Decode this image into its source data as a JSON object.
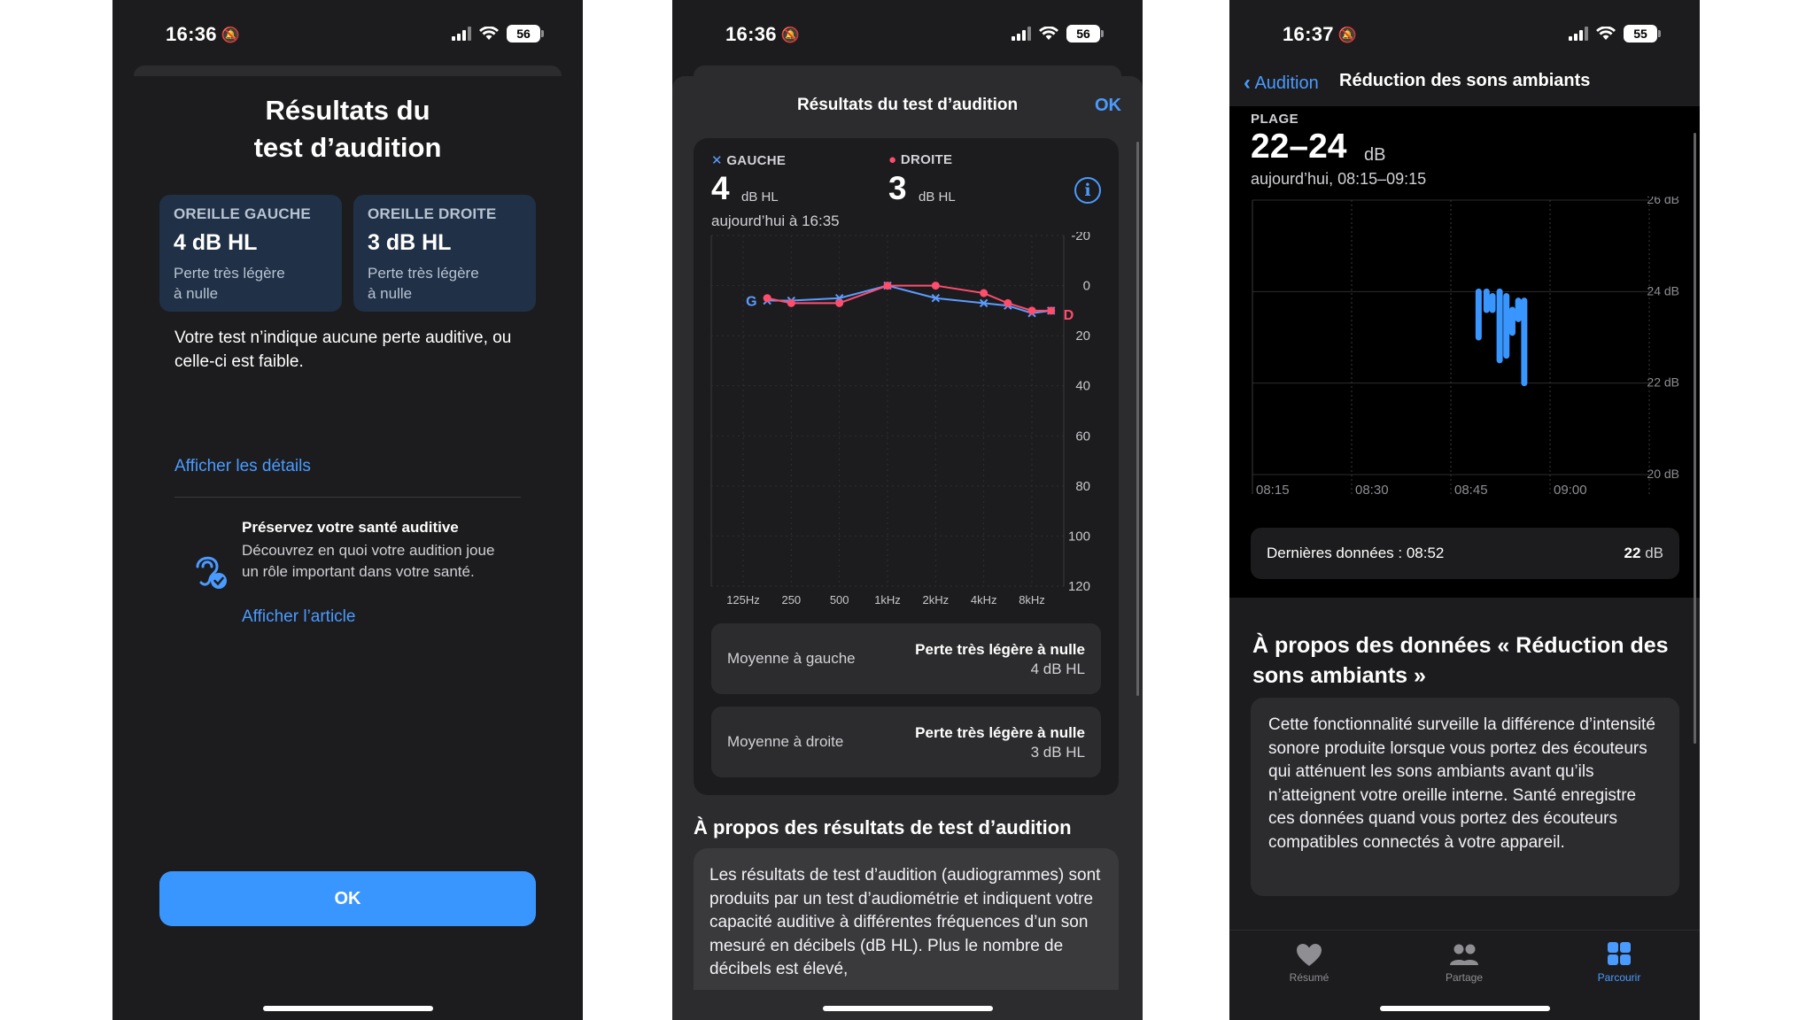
{
  "status": {
    "phone1_time": "16:36",
    "phone2_time": "16:36",
    "phone3_time": "16:37",
    "battery1": "56",
    "battery2": "56",
    "battery3": "55"
  },
  "phone1": {
    "title_line1": "Résultats du",
    "title_line2": "test d’audition",
    "left_ear": {
      "label": "OREILLE GAUCHE",
      "value": "4 dB HL",
      "desc1": "Perte très légère",
      "desc2": "à nulle"
    },
    "right_ear": {
      "label": "OREILLE DROITE",
      "value": "3 dB HL",
      "desc1": "Perte très légère",
      "desc2": "à nulle"
    },
    "message": "Votre test n’indique aucune perte auditive, ou celle-ci est faible.",
    "details_link": "Afficher les détails",
    "article_title": "Préservez votre santé auditive",
    "article_body": "Découvrez en quoi votre audition joue un rôle important dans votre santé.",
    "article_link": "Afficher l’article",
    "ok_label": "OK"
  },
  "phone2": {
    "header": "Résultats du test d’audition",
    "ok_label": "OK",
    "left_legend": "GAUCHE",
    "right_legend": "DROITE",
    "left_value": "4",
    "right_value": "3",
    "unit": "dB HL",
    "date": "aujourd’hui à 16:35",
    "avg_left_label": "Moyenne à gauche",
    "avg_left_result": "Perte très légère à nulle",
    "avg_left_value": "4 dB HL",
    "avg_right_label": "Moyenne à droite",
    "avg_right_result": "Perte très légère à nulle",
    "avg_right_value": "3 dB HL",
    "about_title": "À propos des résultats de test d’audition",
    "about_body": "Les résultats de test d’audition (audiogrammes) sont produits par un test d’audiométrie et indiquent votre capacité auditive à différentes fréquences d’un son mesuré en décibels (dB HL). Plus le nombre de décibels est élevé,"
  },
  "phone3": {
    "back_label": "Audition",
    "title": "Réduction des sons ambiants",
    "range_label": "PLAGE",
    "range_value": "22–24",
    "range_unit": "dB",
    "date": "aujourd’hui, 08:15–09:15",
    "last_label": "Dernières données : 08:52",
    "last_value": "22",
    "last_unit": "dB",
    "about_title": "À propos des données « Réduction des sons ambiants »",
    "about_body": "Cette fonctionnalité surveille la différence d’intensité sonore produite lorsque vous portez des écouteurs qui atténuent les sons ambiants avant qu’ils n’atteignent votre oreille interne. Santé enregistre ces données quand vous portez des écouteurs compatibles connectés à votre appareil.",
    "tabs": [
      {
        "label": "Résumé",
        "icon": "heart-icon"
      },
      {
        "label": "Partage",
        "icon": "people-icon"
      },
      {
        "label": "Parcourir",
        "icon": "grid-icon"
      }
    ]
  },
  "colors": {
    "accent": "#4a9bff",
    "left_series": "#5b9cff",
    "right_series": "#ff4d6d",
    "noise_bars": "#3a96ff"
  },
  "chart_data": [
    {
      "type": "line",
      "xlabel": "",
      "ylabel": "",
      "x": [
        "125Hz",
        "250",
        "500",
        "1kHz",
        "2kHz",
        "4kHz",
        "8kHz"
      ],
      "ylim": [
        -20,
        120
      ],
      "y_inverted": true,
      "yticks": [
        "-20",
        "0",
        "20",
        "40",
        "60",
        "80",
        "100",
        "120"
      ],
      "start_label_left": "G",
      "end_label_right": "D",
      "series": [
        {
          "name": "GAUCHE",
          "marker": "x",
          "points": [
            [
              0.5,
              6
            ],
            [
              1,
              6
            ],
            [
              2,
              5
            ],
            [
              3,
              0
            ],
            [
              4,
              5
            ],
            [
              5,
              7
            ],
            [
              5.5,
              8
            ],
            [
              6,
              11
            ],
            [
              6.4,
              10
            ]
          ]
        },
        {
          "name": "DROITE",
          "marker": "o",
          "points": [
            [
              0.5,
              5
            ],
            [
              1,
              7
            ],
            [
              2,
              7
            ],
            [
              3,
              0
            ],
            [
              4,
              0
            ],
            [
              5,
              3
            ],
            [
              5.5,
              7
            ],
            [
              6,
              10
            ],
            [
              6.4,
              10
            ]
          ]
        }
      ]
    },
    {
      "type": "bar",
      "xlabel": "",
      "ylabel": "",
      "x_ticks": [
        "08:15",
        "08:30",
        "08:45",
        "09:00"
      ],
      "y_ticks": [
        "20 dB",
        "22 dB",
        "24 dB",
        "26 dB"
      ],
      "ylim": [
        20,
        26
      ],
      "bars": [
        {
          "t": 8.82,
          "low": 23.0,
          "high": 24.0
        },
        {
          "t": 8.84,
          "low": 23.6,
          "high": 24.0
        },
        {
          "t": 8.855,
          "low": 23.6,
          "high": 23.9
        },
        {
          "t": 8.873,
          "low": 22.5,
          "high": 24.0
        },
        {
          "t": 8.89,
          "low": 22.6,
          "high": 23.9
        },
        {
          "t": 8.905,
          "low": 23.1,
          "high": 23.6
        },
        {
          "t": 8.92,
          "low": 23.4,
          "high": 23.8
        },
        {
          "t": 8.935,
          "low": 22.0,
          "high": 23.8
        }
      ]
    }
  ]
}
